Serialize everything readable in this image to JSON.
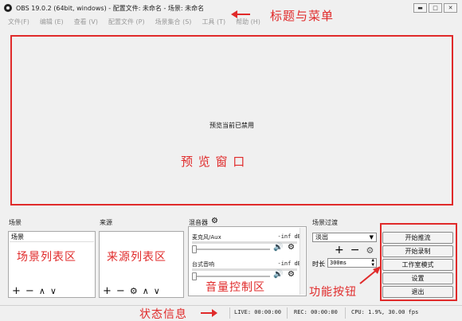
{
  "window": {
    "title": "OBS 19.0.2 (64bit, windows) - 配置文件: 未命名 - 场景: 未命名",
    "controls": {
      "minimize": "▭",
      "maximize": "□",
      "close": "✕"
    }
  },
  "menu": [
    "文件(F)",
    "编辑 (E)",
    "查看 (V)",
    "配置文件 (P)",
    "场景集合 (S)",
    "工具 (T)",
    "帮助 (H)"
  ],
  "preview": {
    "message": "预览当前已禁用"
  },
  "annotations": {
    "title_menu": "标题与菜单",
    "preview": "预 览 窗 口",
    "scene_list": "场景列表区",
    "source_list": "来源列表区",
    "audio_mixer": "音量控制区",
    "controls": "功能按钮",
    "status": "状态信息"
  },
  "docks": {
    "scenes": {
      "label": "场景",
      "items": [
        "场景"
      ]
    },
    "sources": {
      "label": "来源"
    },
    "mixer": {
      "label": "混音器",
      "tracks": [
        {
          "name": "麦克风/Aux",
          "db": "-inf dB"
        },
        {
          "name": "台式音响",
          "db": "-inf dB"
        }
      ]
    },
    "transitions": {
      "label": "场景过渡",
      "selected": "淡出",
      "duration_label": "时长",
      "duration_value": "300ms"
    }
  },
  "controls": [
    "开始推流",
    "开始录制",
    "工作室模式",
    "设置",
    "退出"
  ],
  "status": {
    "live": "LIVE: 00:00:00",
    "rec": "REC: 00:00:00",
    "cpu": "CPU: 1.9%, 30.00 fps"
  },
  "icons": {
    "add": "+",
    "remove": "−",
    "up": "∧",
    "down": "∨",
    "gear": "⚙",
    "speaker": "🔊"
  },
  "colors": {
    "annotation": "#e02a2a"
  }
}
